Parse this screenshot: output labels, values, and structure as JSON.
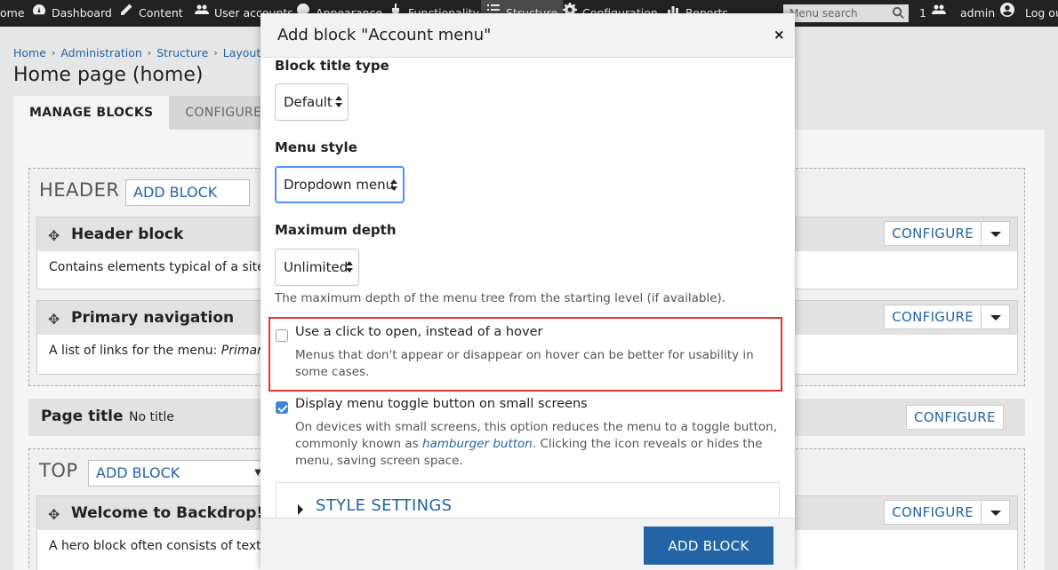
{
  "admin_bar": {
    "items": [
      "ome",
      "Dashboard",
      "Content",
      "User accounts",
      "Appearance",
      "Functionality",
      "Structure",
      "Configuration",
      "Reports"
    ],
    "search_placeholder": "Menu search",
    "user_count": "1",
    "username": "admin",
    "logout": "Log ou"
  },
  "breadcrumb": [
    "Home",
    "Administration",
    "Structure",
    "Layouts"
  ],
  "page_title": "Home page (home)",
  "tabs": [
    "MANAGE BLOCKS",
    "CONFIGURE"
  ],
  "regions": {
    "header": {
      "label": "HEADER",
      "add_block": "ADD BLOCK",
      "blocks": [
        {
          "title": "Header block",
          "description": "Contains elements typical of a site h",
          "configure": "CONFIGURE"
        },
        {
          "title": "Primary navigation",
          "description_prefix": "A list of links for the menu: ",
          "description_em": "Primary",
          "configure": "CONFIGURE"
        }
      ]
    },
    "page_title_row": {
      "title": "Page title",
      "value": "No title",
      "configure": "CONFIGURE"
    },
    "top": {
      "label": "TOP",
      "add_block": "ADD BLOCK",
      "blocks": [
        {
          "title": "Welcome to Backdrop!",
          "description": "A hero block often consists of text o",
          "configure": "CONFIGURE"
        }
      ]
    }
  },
  "dialog": {
    "title": "Add block \"Account menu\"",
    "close": "×",
    "fields": {
      "block_title_type": {
        "label": "Block title type",
        "value": "Default"
      },
      "menu_style": {
        "label": "Menu style",
        "value": "Dropdown menu"
      },
      "maximum_depth": {
        "label": "Maximum depth",
        "value": "Unlimited",
        "help": "The maximum depth of the menu tree from the starting level (if available)."
      },
      "click_to_open": {
        "label": "Use a click to open, instead of a hover",
        "checked": false,
        "help_line1": "Menus that don't appear or disappear on hover can be better for usability in",
        "help_line2": "some cases."
      },
      "toggle_button": {
        "label": "Display menu toggle button on small screens",
        "checked": true,
        "help_line1": "On devices with small screens, this option reduces the menu to a toggle button,",
        "help_line2_prefix": "commonly known as ",
        "help_link": "hamburger button",
        "help_line2_suffix": ". Clicking the icon reveals or hides the",
        "help_line3": "menu, saving screen space."
      }
    },
    "style_settings": "STYLE SETTINGS",
    "submit": "ADD BLOCK"
  },
  "colors": {
    "link": "#2264a5",
    "admin_bar": "#222222",
    "primary_button": "#2264a5",
    "highlight": "#e8312d",
    "checkbox_checked": "#3a86d6"
  }
}
